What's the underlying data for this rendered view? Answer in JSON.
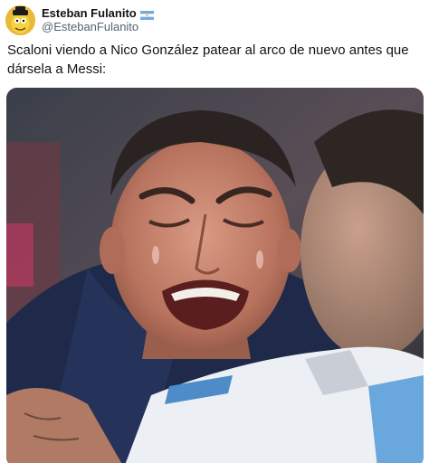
{
  "tweet": {
    "author": {
      "display_name": "Esteban Fulanito",
      "handle": "@EstebanFulanito",
      "avatar_icon": "cartoon-avatar-icon",
      "flag_icon": "argentina-flag-icon"
    },
    "text": "Scaloni viendo a Nico González patear al arco de nuevo antes que dársela a Messi:",
    "media": {
      "description_icon": "crying-coach-photo"
    }
  },
  "colors": {
    "text": "#0f1419",
    "secondary": "#536471",
    "flag_blue": "#75aadb"
  }
}
